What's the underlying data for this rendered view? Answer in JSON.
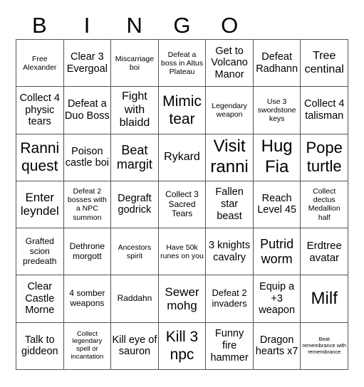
{
  "header": {
    "letters": [
      "B",
      "I",
      "N",
      "G",
      "O"
    ]
  },
  "board": {
    "columns": 7,
    "rows": 7,
    "cells": [
      [
        "Free Alexander",
        "Clear 3 Evergoal",
        "Miscarriage boi",
        "Defeat a boss in Altus Plateau",
        "Get to Volcano Manor",
        "Defeat Radhann",
        "Tree centinal"
      ],
      [
        "Collect 4 physic tears",
        "Defeat a Duo Boss",
        "Fight with blaidd",
        "Mimic tear",
        "Legendary weapon",
        "Use 3 swordstone keys",
        "Collect 4 talisman"
      ],
      [
        "Ranni quest",
        "Poison castle boi",
        "Beat margit",
        "Rykard",
        "Visit ranni",
        "Hug Fia",
        "Pope turtle"
      ],
      [
        "Enter leyndel",
        "Defeat 2 bosses with a NPC summon",
        "Degraft godrick",
        "Collect 3 Sacred Tears",
        "Fallen star beast",
        "Reach Level 45",
        "Collect dectus Medallion half"
      ],
      [
        "Grafted scion predeath",
        "Dethrone morgott",
        "Ancestors spirit",
        "Have 50k runes on you",
        "3 knights cavalry",
        "Putrid worm",
        "Erdtree avatar"
      ],
      [
        "Clear Castle Morne",
        "4 somber weapons",
        "Raddahn",
        "Sewer mohg",
        "Defeat 2 invaders",
        "Equip a +3 weapon",
        "Milf"
      ],
      [
        "Talk to giddeon",
        "Collect legendary spell or incantation",
        "Kill eye of sauron",
        "Kill 3 npc",
        "Funny fire hammer",
        "Dragon hearts x7",
        "Beat remembrance with remembrance"
      ]
    ]
  }
}
